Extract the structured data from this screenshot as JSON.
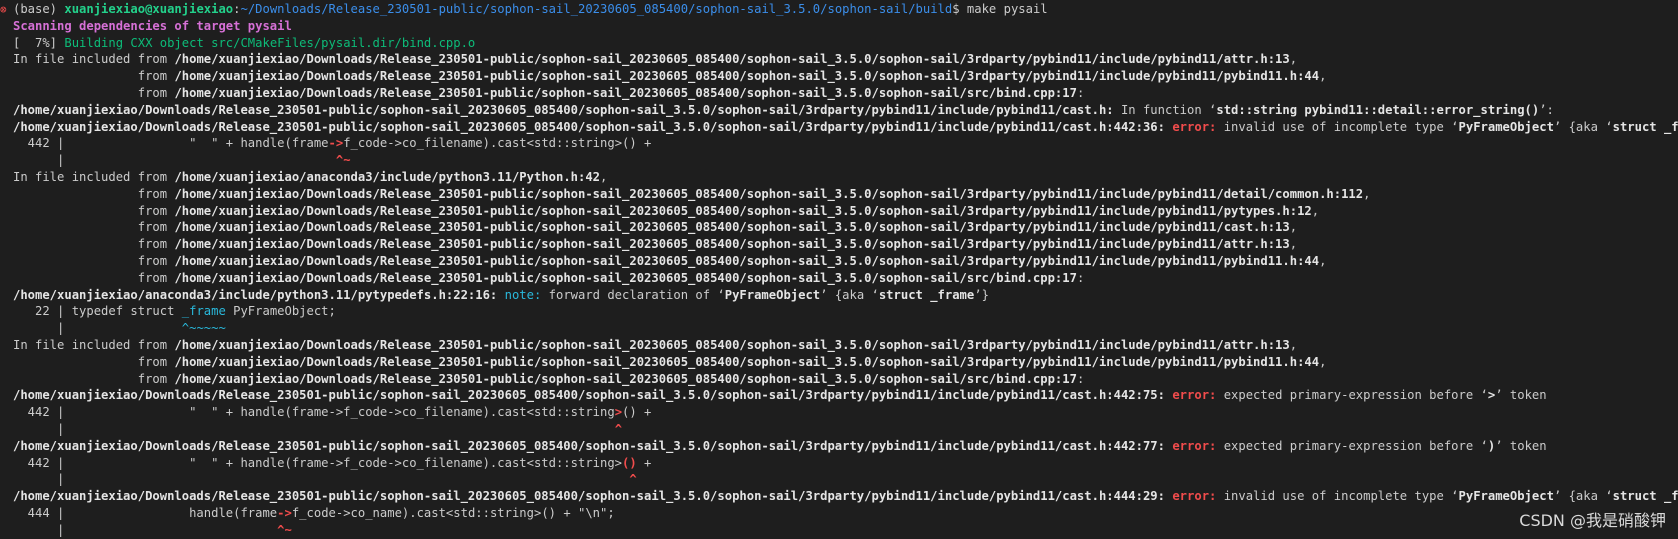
{
  "prompt": {
    "status_icon": "⊗",
    "env": "(base) ",
    "user_host": "xuanjiexiao@xuanjiexiao",
    "sep": ":",
    "cwd": "~/Downloads/Release_230501-public/sophon-sail_20230605_085400/sophon-sail_3.5.0/sophon-sail/build",
    "dollar": "$ ",
    "command": "make pysail"
  },
  "lines": [
    {
      "segments": [
        {
          "text": "Scanning dependencies of target pysail",
          "style": "magenta-b"
        }
      ]
    },
    {
      "segments": [
        {
          "text": "[  7%] "
        },
        {
          "text": "Building CXX object src/CMakeFiles/pysail.dir/bind.cpp.o",
          "style": "green"
        }
      ]
    },
    {
      "segments": [
        {
          "text": "In file included from "
        },
        {
          "text": "/home/xuanjiexiao/Downloads/Release_230501-public/sophon-sail_20230605_085400/sophon-sail_3.5.0/sophon-sail/3rdparty/pybind11/include/pybind11/attr.h:13",
          "style": "white-b"
        },
        {
          "text": ","
        }
      ]
    },
    {
      "segments": [
        {
          "text": "                 from "
        },
        {
          "text": "/home/xuanjiexiao/Downloads/Release_230501-public/sophon-sail_20230605_085400/sophon-sail_3.5.0/sophon-sail/3rdparty/pybind11/include/pybind11/pybind11.h:44",
          "style": "white-b"
        },
        {
          "text": ","
        }
      ]
    },
    {
      "segments": [
        {
          "text": "                 from "
        },
        {
          "text": "/home/xuanjiexiao/Downloads/Release_230501-public/sophon-sail_20230605_085400/sophon-sail_3.5.0/sophon-sail/src/bind.cpp:17",
          "style": "white-b"
        },
        {
          "text": ":"
        }
      ]
    },
    {
      "segments": [
        {
          "text": "/home/xuanjiexiao/Downloads/Release_230501-public/sophon-sail_20230605_085400/sophon-sail_3.5.0/sophon-sail/3rdparty/pybind11/include/pybind11/cast.h:",
          "style": "white-b"
        },
        {
          "text": " In function ‘"
        },
        {
          "text": "std::string pybind11::detail::error_string()",
          "style": "white-b"
        },
        {
          "text": "’:"
        }
      ]
    },
    {
      "segments": [
        {
          "text": "/home/xuanjiexiao/Downloads/Release_230501-public/sophon-sail_20230605_085400/sophon-sail_3.5.0/sophon-sail/3rdparty/pybind11/include/pybind11/cast.h:442:36:",
          "style": "white-b"
        },
        {
          "text": " "
        },
        {
          "text": "error:",
          "style": "red-b"
        },
        {
          "text": " invalid use of incomplete type ‘"
        },
        {
          "text": "PyFrameObject",
          "style": "white-b"
        },
        {
          "text": "’ {aka ‘"
        },
        {
          "text": "struct _frame",
          "style": "white-b"
        },
        {
          "text": "’}"
        }
      ]
    },
    {
      "segments": [
        {
          "text": "  442 |                 \"  \" + handle(frame"
        },
        {
          "text": "->",
          "style": "red-b"
        },
        {
          "text": "f_code->co_filename).cast<std::string>() +"
        }
      ]
    },
    {
      "segments": [
        {
          "text": "      |                                     "
        },
        {
          "text": "^~",
          "style": "red-b"
        }
      ]
    },
    {
      "segments": [
        {
          "text": "In file included from "
        },
        {
          "text": "/home/xuanjiexiao/anaconda3/include/python3.11/Python.h:42",
          "style": "white-b"
        },
        {
          "text": ","
        }
      ]
    },
    {
      "segments": [
        {
          "text": "                 from "
        },
        {
          "text": "/home/xuanjiexiao/Downloads/Release_230501-public/sophon-sail_20230605_085400/sophon-sail_3.5.0/sophon-sail/3rdparty/pybind11/include/pybind11/detail/common.h:112",
          "style": "white-b"
        },
        {
          "text": ","
        }
      ]
    },
    {
      "segments": [
        {
          "text": "                 from "
        },
        {
          "text": "/home/xuanjiexiao/Downloads/Release_230501-public/sophon-sail_20230605_085400/sophon-sail_3.5.0/sophon-sail/3rdparty/pybind11/include/pybind11/pytypes.h:12",
          "style": "white-b"
        },
        {
          "text": ","
        }
      ]
    },
    {
      "segments": [
        {
          "text": "                 from "
        },
        {
          "text": "/home/xuanjiexiao/Downloads/Release_230501-public/sophon-sail_20230605_085400/sophon-sail_3.5.0/sophon-sail/3rdparty/pybind11/include/pybind11/cast.h:13",
          "style": "white-b"
        },
        {
          "text": ","
        }
      ]
    },
    {
      "segments": [
        {
          "text": "                 from "
        },
        {
          "text": "/home/xuanjiexiao/Downloads/Release_230501-public/sophon-sail_20230605_085400/sophon-sail_3.5.0/sophon-sail/3rdparty/pybind11/include/pybind11/attr.h:13",
          "style": "white-b"
        },
        {
          "text": ","
        }
      ]
    },
    {
      "segments": [
        {
          "text": "                 from "
        },
        {
          "text": "/home/xuanjiexiao/Downloads/Release_230501-public/sophon-sail_20230605_085400/sophon-sail_3.5.0/sophon-sail/3rdparty/pybind11/include/pybind11/pybind11.h:44",
          "style": "white-b"
        },
        {
          "text": ","
        }
      ]
    },
    {
      "segments": [
        {
          "text": "                 from "
        },
        {
          "text": "/home/xuanjiexiao/Downloads/Release_230501-public/sophon-sail_20230605_085400/sophon-sail_3.5.0/sophon-sail/src/bind.cpp:17",
          "style": "white-b"
        },
        {
          "text": ":"
        }
      ]
    },
    {
      "segments": [
        {
          "text": "/home/xuanjiexiao/anaconda3/include/python3.11/pytypedefs.h:22:16:",
          "style": "white-b"
        },
        {
          "text": " "
        },
        {
          "text": "note:",
          "style": "cyan"
        },
        {
          "text": " forward declaration of ‘"
        },
        {
          "text": "PyFrameObject",
          "style": "white-b"
        },
        {
          "text": "’ {aka ‘"
        },
        {
          "text": "struct _frame",
          "style": "white-b"
        },
        {
          "text": "’}"
        }
      ]
    },
    {
      "segments": [
        {
          "text": "   22 | typedef struct "
        },
        {
          "text": "_frame",
          "style": "cyan"
        },
        {
          "text": " PyFrameObject;"
        }
      ]
    },
    {
      "segments": [
        {
          "text": "      |                "
        },
        {
          "text": "^~~~~~",
          "style": "cyan"
        }
      ]
    },
    {
      "segments": [
        {
          "text": "In file included from "
        },
        {
          "text": "/home/xuanjiexiao/Downloads/Release_230501-public/sophon-sail_20230605_085400/sophon-sail_3.5.0/sophon-sail/3rdparty/pybind11/include/pybind11/attr.h:13",
          "style": "white-b"
        },
        {
          "text": ","
        }
      ]
    },
    {
      "segments": [
        {
          "text": "                 from "
        },
        {
          "text": "/home/xuanjiexiao/Downloads/Release_230501-public/sophon-sail_20230605_085400/sophon-sail_3.5.0/sophon-sail/3rdparty/pybind11/include/pybind11/pybind11.h:44",
          "style": "white-b"
        },
        {
          "text": ","
        }
      ]
    },
    {
      "segments": [
        {
          "text": "                 from "
        },
        {
          "text": "/home/xuanjiexiao/Downloads/Release_230501-public/sophon-sail_20230605_085400/sophon-sail_3.5.0/sophon-sail/src/bind.cpp:17",
          "style": "white-b"
        },
        {
          "text": ":"
        }
      ]
    },
    {
      "segments": [
        {
          "text": "/home/xuanjiexiao/Downloads/Release_230501-public/sophon-sail_20230605_085400/sophon-sail_3.5.0/sophon-sail/3rdparty/pybind11/include/pybind11/cast.h:442:75:",
          "style": "white-b"
        },
        {
          "text": " "
        },
        {
          "text": "error:",
          "style": "red-b"
        },
        {
          "text": " expected primary-expression before ‘"
        },
        {
          "text": ">",
          "style": "white-b"
        },
        {
          "text": "’ token"
        }
      ]
    },
    {
      "segments": [
        {
          "text": "  442 |                 \"  \" + handle(frame->f_code->co_filename).cast<std::string"
        },
        {
          "text": ">",
          "style": "red-b"
        },
        {
          "text": "() +"
        }
      ]
    },
    {
      "segments": [
        {
          "text": "      |                                                                           "
        },
        {
          "text": "^",
          "style": "red-b"
        }
      ]
    },
    {
      "segments": [
        {
          "text": "/home/xuanjiexiao/Downloads/Release_230501-public/sophon-sail_20230605_085400/sophon-sail_3.5.0/sophon-sail/3rdparty/pybind11/include/pybind11/cast.h:442:77:",
          "style": "white-b"
        },
        {
          "text": " "
        },
        {
          "text": "error:",
          "style": "red-b"
        },
        {
          "text": " expected primary-expression before ‘"
        },
        {
          "text": ")",
          "style": "white-b"
        },
        {
          "text": "’ token"
        }
      ]
    },
    {
      "segments": [
        {
          "text": "  442 |                 \"  \" + handle(frame->f_code->co_filename).cast<std::string>"
        },
        {
          "text": "()",
          "style": "red-b"
        },
        {
          "text": " +"
        }
      ]
    },
    {
      "segments": [
        {
          "text": "      |                                                                             "
        },
        {
          "text": "^",
          "style": "red-b"
        }
      ]
    },
    {
      "segments": [
        {
          "text": "/home/xuanjiexiao/Downloads/Release_230501-public/sophon-sail_20230605_085400/sophon-sail_3.5.0/sophon-sail/3rdparty/pybind11/include/pybind11/cast.h:444:29:",
          "style": "white-b"
        },
        {
          "text": " "
        },
        {
          "text": "error:",
          "style": "red-b"
        },
        {
          "text": " invalid use of incomplete type ‘"
        },
        {
          "text": "PyFrameObject",
          "style": "white-b"
        },
        {
          "text": "’ {aka ‘"
        },
        {
          "text": "struct _frame",
          "style": "white-b"
        },
        {
          "text": "’}"
        }
      ]
    },
    {
      "segments": [
        {
          "text": "  444 |                 handle(frame"
        },
        {
          "text": "->",
          "style": "red-b"
        },
        {
          "text": "f_code->co_name).cast<std::string>() + \"\\n\";"
        }
      ]
    },
    {
      "segments": [
        {
          "text": "      |                             "
        },
        {
          "text": "^~",
          "style": "red-b"
        }
      ]
    }
  ],
  "watermark": "CSDN @我是硝酸钾"
}
